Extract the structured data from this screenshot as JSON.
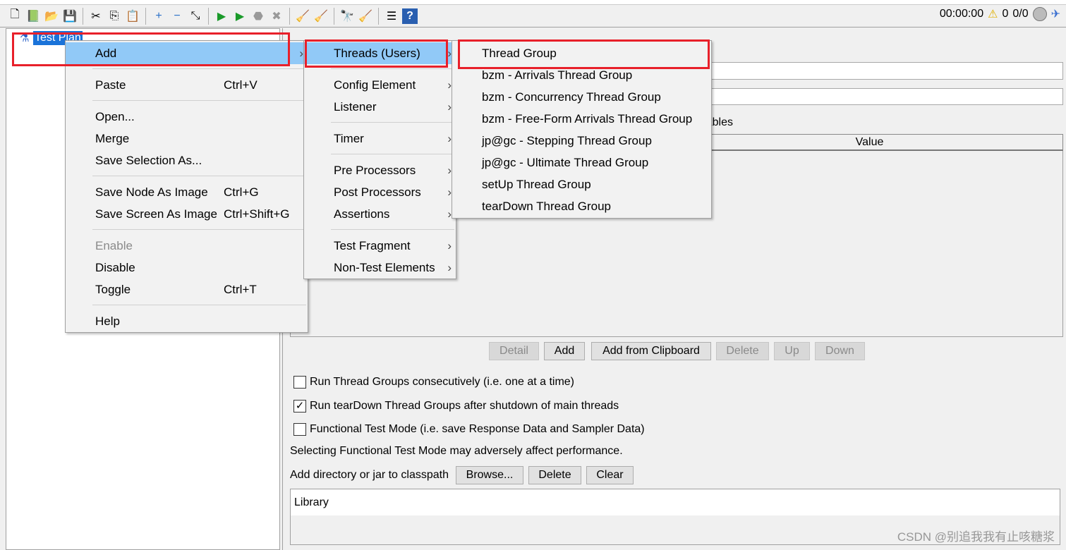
{
  "toolbar": {
    "icons": [
      "new-icon",
      "templates-icon",
      "open-icon",
      "save-icon",
      "cut-icon",
      "copy-icon",
      "paste-icon",
      "expand-icon",
      "collapse-icon",
      "toggle-icon",
      "start-icon",
      "start-no-pause-icon",
      "stop-icon",
      "shutdown-icon",
      "clear-icon",
      "clear-all-icon",
      "search-icon",
      "reset-search-icon",
      "function-helper-icon",
      "help-icon"
    ],
    "timer": "00:00:00",
    "warnings": "0",
    "threads": "0/0"
  },
  "tree": {
    "root": "Test Plan"
  },
  "context_menu": {
    "items": [
      {
        "label": "Add",
        "shortcut": "",
        "submenu": true,
        "highlight": true
      },
      {
        "sep": true
      },
      {
        "label": "Paste",
        "shortcut": "Ctrl+V"
      },
      {
        "sep": true
      },
      {
        "label": "Open..."
      },
      {
        "label": "Merge"
      },
      {
        "label": "Save Selection As..."
      },
      {
        "sep": true
      },
      {
        "label": "Save Node As Image",
        "shortcut": "Ctrl+G"
      },
      {
        "label": "Save Screen As Image",
        "shortcut": "Ctrl+Shift+G"
      },
      {
        "sep": true
      },
      {
        "label": "Enable",
        "disabled": true
      },
      {
        "label": "Disable"
      },
      {
        "label": "Toggle",
        "shortcut": "Ctrl+T"
      },
      {
        "sep": true
      },
      {
        "label": "Help"
      }
    ]
  },
  "add_submenu": {
    "items": [
      {
        "label": "Threads (Users)",
        "submenu": true,
        "highlight": true
      },
      {
        "sep": true
      },
      {
        "label": "Config Element",
        "submenu": true
      },
      {
        "label": "Listener",
        "submenu": true
      },
      {
        "sep": true
      },
      {
        "label": "Timer",
        "submenu": true
      },
      {
        "sep": true
      },
      {
        "label": "Pre Processors",
        "submenu": true
      },
      {
        "label": "Post Processors",
        "submenu": true
      },
      {
        "label": "Assertions",
        "submenu": true
      },
      {
        "sep": true
      },
      {
        "label": "Test Fragment",
        "submenu": true
      },
      {
        "label": "Non-Test Elements",
        "submenu": true
      }
    ]
  },
  "threads_submenu": {
    "items": [
      {
        "label": "Thread Group"
      },
      {
        "label": "bzm - Arrivals Thread Group"
      },
      {
        "label": "bzm - Concurrency Thread Group"
      },
      {
        "label": "bzm - Free-Form Arrivals Thread Group"
      },
      {
        "label": "jp@gc - Stepping Thread Group"
      },
      {
        "label": "jp@gc - Ultimate Thread Group"
      },
      {
        "label": "setUp Thread Group"
      },
      {
        "label": "tearDown Thread Group"
      }
    ]
  },
  "main": {
    "variables_label": "User Defined Variables",
    "table_header": "Value",
    "buttons": [
      "Detail",
      "Add",
      "Add from Clipboard",
      "Delete",
      "Up",
      "Down"
    ],
    "options": [
      {
        "label": "Run Thread Groups consecutively (i.e. one at a time)",
        "checked": false
      },
      {
        "label": "Run tearDown Thread Groups after shutdown of main threads",
        "checked": true
      },
      {
        "label": "Functional Test Mode (i.e. save Response Data and Sampler Data)",
        "checked": false
      }
    ],
    "note": "Selecting Functional Test Mode may adversely affect performance.",
    "classpath_label": "Add directory or jar to classpath",
    "browse": "Browse...",
    "delete": "Delete",
    "clear": "Clear",
    "library_header": "Library"
  },
  "watermark": "CSDN @别追我我有止咳糖浆",
  "colors": {
    "highlight": "#91c9f7",
    "selection": "#1a73d9",
    "annotation": "#e8202a"
  }
}
